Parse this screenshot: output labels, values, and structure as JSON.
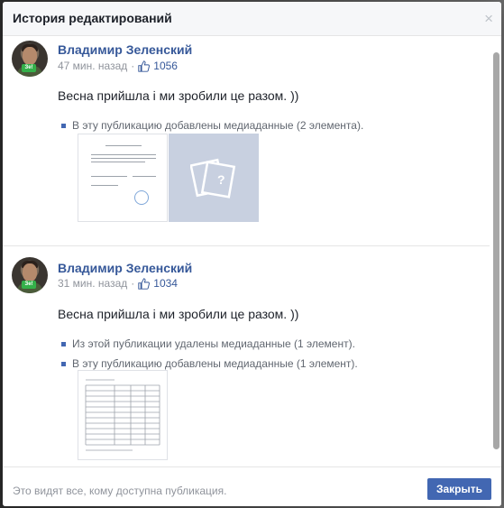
{
  "dialog": {
    "title": "История редактирований",
    "close_glyph": "×"
  },
  "entries": [
    {
      "author": "Владимир Зеленский",
      "time": "47 мин. назад",
      "dot": "·",
      "likes": "1056",
      "avatar_badge": "Зе!",
      "text": "Весна прийшла і ми зробили це разом. ))",
      "changes": [
        "В эту публикацию добавлены медиаданные (2 элемента)."
      ]
    },
    {
      "author": "Владимир Зеленский",
      "time": "31 мин. назад",
      "dot": "·",
      "likes": "1034",
      "avatar_badge": "Зе!",
      "text": "Весна прийшла і ми зробили це разом. ))",
      "changes": [
        "Из этой публикации удалены медиаданные (1 элемент).",
        "В эту публикацию добавлены медиаданные (1 элемент)."
      ]
    }
  ],
  "placeholder_glyph": "?",
  "footer": {
    "note": "Это видят все, кому доступна публикация.",
    "close_label": "Закрыть"
  },
  "colors": {
    "link": "#365899",
    "primary_button": "#4267b2",
    "media_placeholder": "#c8d0e0"
  },
  "icons": [
    "close-icon",
    "like-icon",
    "bullet-icon",
    "photo-placeholder-icon"
  ]
}
